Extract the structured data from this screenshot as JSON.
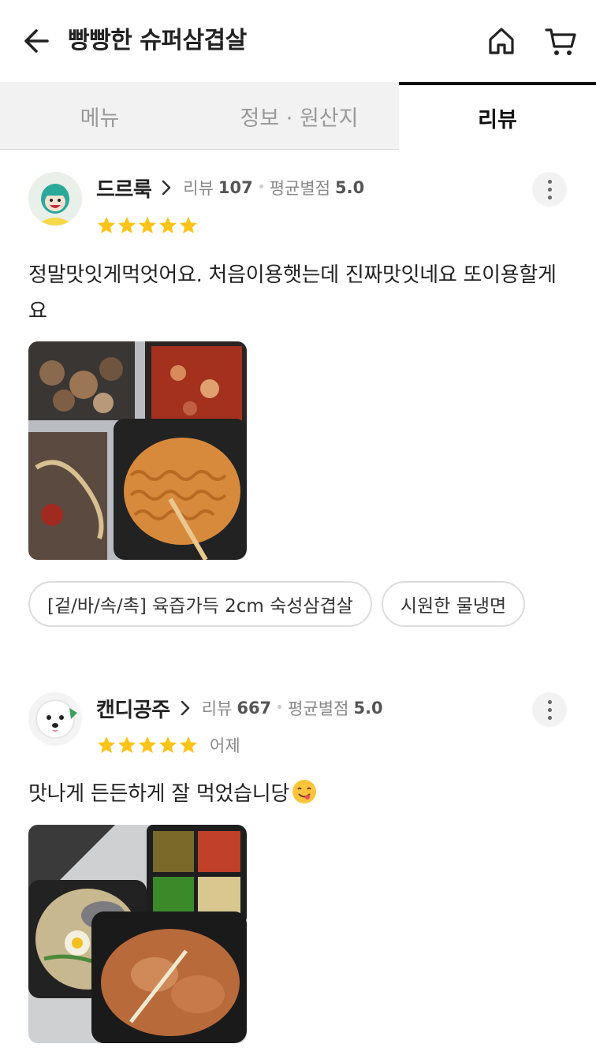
{
  "header": {
    "title": "빵빵한 슈퍼삼겹살",
    "back_icon": "arrow-left-icon",
    "home_icon": "home-icon",
    "cart_icon": "cart-icon"
  },
  "tabs": [
    {
      "label": "메뉴",
      "active": false
    },
    {
      "label": "정보 · 원산지",
      "active": false
    },
    {
      "label": "리뷰",
      "active": true
    }
  ],
  "reviews": [
    {
      "nickname": "드르룩",
      "review_label": "리뷰",
      "review_count": "107",
      "avg_label": "평균별점",
      "avg_rating": "5.0",
      "rating": 5,
      "date": "",
      "text": "정말맛잇게먹엇어요.  처음이용햇는데 진짜맛잇네요 또이용할게요",
      "tags": [
        "[겉/바/속/촉] 육즙가득 2cm 숙성삼겹살",
        "시원한 물냉면"
      ]
    },
    {
      "nickname": "캔디공주",
      "review_label": "리뷰",
      "review_count": "667",
      "avg_label": "평균별점",
      "avg_rating": "5.0",
      "rating": 5,
      "date": "어제",
      "text": "맛나게 든든하게 잘 먹었습니당",
      "tags": []
    }
  ],
  "colors": {
    "star": "#fcc419",
    "active_tab": "#111111",
    "inactive_tab_bg": "#f2f2f2"
  }
}
